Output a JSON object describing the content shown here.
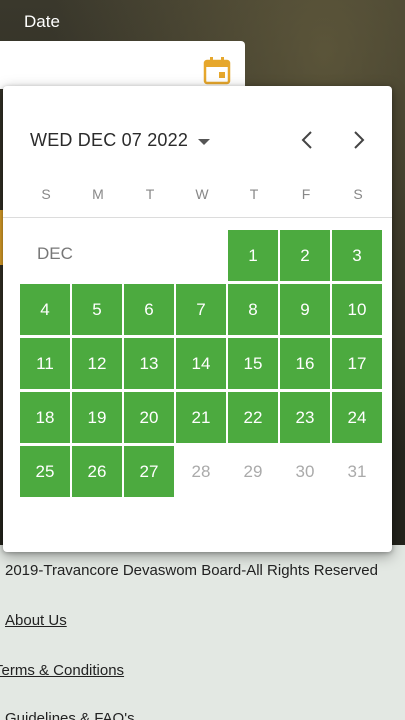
{
  "form": {
    "date_label": "Date"
  },
  "calendar": {
    "header_date": "WED DEC 07 2022",
    "month_tag": "DEC",
    "weekdays": [
      "S",
      "M",
      "T",
      "W",
      "T",
      "F",
      "S"
    ],
    "first_weekday_index": 4,
    "last_available_day": 27,
    "days": [
      "1",
      "2",
      "3",
      "4",
      "5",
      "6",
      "7",
      "8",
      "9",
      "10",
      "11",
      "12",
      "13",
      "14",
      "15",
      "16",
      "17",
      "18",
      "19",
      "20",
      "21",
      "22",
      "23",
      "24",
      "25",
      "26",
      "27",
      "28",
      "29",
      "30",
      "31"
    ],
    "available_color": "#4caa3f",
    "unavailable_color": "#aaaaaa"
  },
  "footer": {
    "copyright": "2019-Travancore Devaswom Board-All Rights Reserved",
    "links": [
      "About Us",
      "Terms & Conditions",
      "Guidelines & FAQ's"
    ]
  },
  "icons": {
    "calendar": "calendar-icon",
    "prev": "chevron-left-icon",
    "next": "chevron-right-icon",
    "dropdown": "caret-down-icon"
  }
}
